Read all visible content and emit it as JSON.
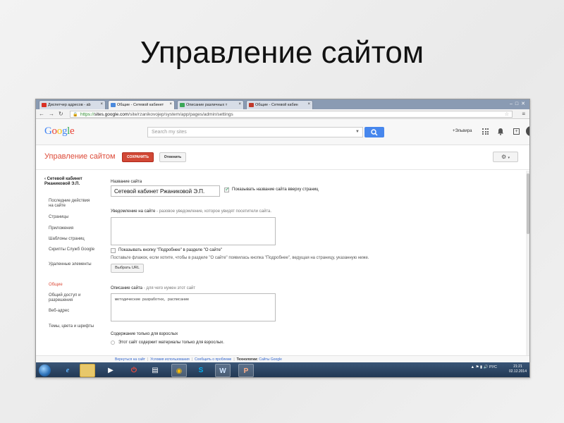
{
  "slide": {
    "title": "Управление сайтом"
  },
  "browser": {
    "tabs": [
      {
        "label": "Диспетчер адресов - ab",
        "color": "#d93025"
      },
      {
        "label": "Общие - Сетевой кабинет",
        "color": "#4a89dc"
      },
      {
        "label": "Описание различных т",
        "color": "#3aa757"
      },
      {
        "label": "Общие - Сетевой кабин",
        "color": "#c0392b"
      }
    ],
    "url_scheme": "https://",
    "url_host": "sites.google.com",
    "url_path": "/site/rzanikovojep/system/app/pages/admin/settings"
  },
  "google": {
    "logo": "Google",
    "search_placeholder": "Search my sites",
    "user": "+Эльвира"
  },
  "page": {
    "title": "Управление сайтом",
    "save_label": "СОХРАНИТЬ",
    "cancel_label": "Отменить"
  },
  "sidebar": {
    "back_label": "Сетевой кабинет Ржаниковой Э.П.",
    "items": [
      "Последние действия на сайте",
      "Страницы",
      "Приложения",
      "Шаблоны страниц",
      "Скрипты Служб Google",
      "Удаленные элементы",
      "Общие",
      "Общий доступ и разрешения",
      "Веб-адрес",
      "Темы, цвета и шрифты"
    ],
    "active_index": 6
  },
  "form": {
    "site_name_label": "Название сайта",
    "site_name_value": "Сетевой кабинет Ржаниковой Э.П.",
    "show_name_label": "Показывать название сайта вверху страниц",
    "notice_label": "Уведомление на сайте",
    "notice_hint": "- разовое уведомление, которое увидят посетители сайта.",
    "about_checkbox_label": "Показывать кнопку \"Подробнее\" в разделе \"О сайте\"",
    "about_hint": "Поставьте флажок, если хотите, чтобы в разделе \"О сайте\" появилась кнопка \"Подробнее\", ведущая на страницу, указанную ниже.",
    "select_url_label": "Выбрать URL",
    "description_label": "Описание сайта",
    "description_hint": "- для чего нужен этот сайт",
    "description_value": "методические разработки, расписание",
    "adult_label": "Содержание только для взрослых",
    "adult_checkbox_label": "Этот сайт содержит материалы только для взрослых."
  },
  "footer": {
    "back": "Вернуться на сайт",
    "terms": "Условия использования",
    "report": "Сообщить о проблеме",
    "tech_label": "Технологии:",
    "tech_value": "Сайты Google"
  },
  "taskbar": {
    "lang": "РУС",
    "time": "21:21",
    "date": "02.12.2014"
  }
}
